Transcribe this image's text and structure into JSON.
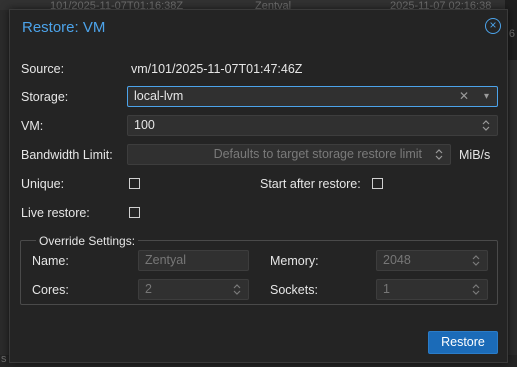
{
  "background": {
    "row_text_1": "101/2025-11-07T01:16:38Z",
    "row_text_2": "Zentyal",
    "row_text_3": "2025-11-07 02:16:38",
    "side_text_1": "6",
    "bottom_text": "s"
  },
  "dialog": {
    "title": "Restore: VM",
    "source_label": "Source:",
    "source_value": "vm/101/2025-11-07T01:47:46Z",
    "storage_label": "Storage:",
    "storage_value": "local-lvm",
    "vm_label": "VM:",
    "vm_value": "100",
    "bandwidth_label": "Bandwidth Limit:",
    "bandwidth_placeholder": "Defaults to target storage restore limit",
    "bandwidth_unit": "MiB/s",
    "unique_label": "Unique:",
    "start_after_label": "Start after restore:",
    "live_restore_label": "Live restore:",
    "override_legend": "Override Settings:",
    "name_label": "Name:",
    "name_value": "Zentyal",
    "memory_label": "Memory:",
    "memory_value": "2048",
    "cores_label": "Cores:",
    "cores_value": "2",
    "sockets_label": "Sockets:",
    "sockets_value": "1",
    "restore_button": "Restore"
  },
  "colors": {
    "accent": "#4ca3ea",
    "button": "#1b6bb8",
    "dialog_bg": "#242424"
  },
  "icons": {
    "close": "close-icon",
    "clear": "clear-icon",
    "dropdown": "chevron-down-icon",
    "spinner": "spinner-icon"
  }
}
